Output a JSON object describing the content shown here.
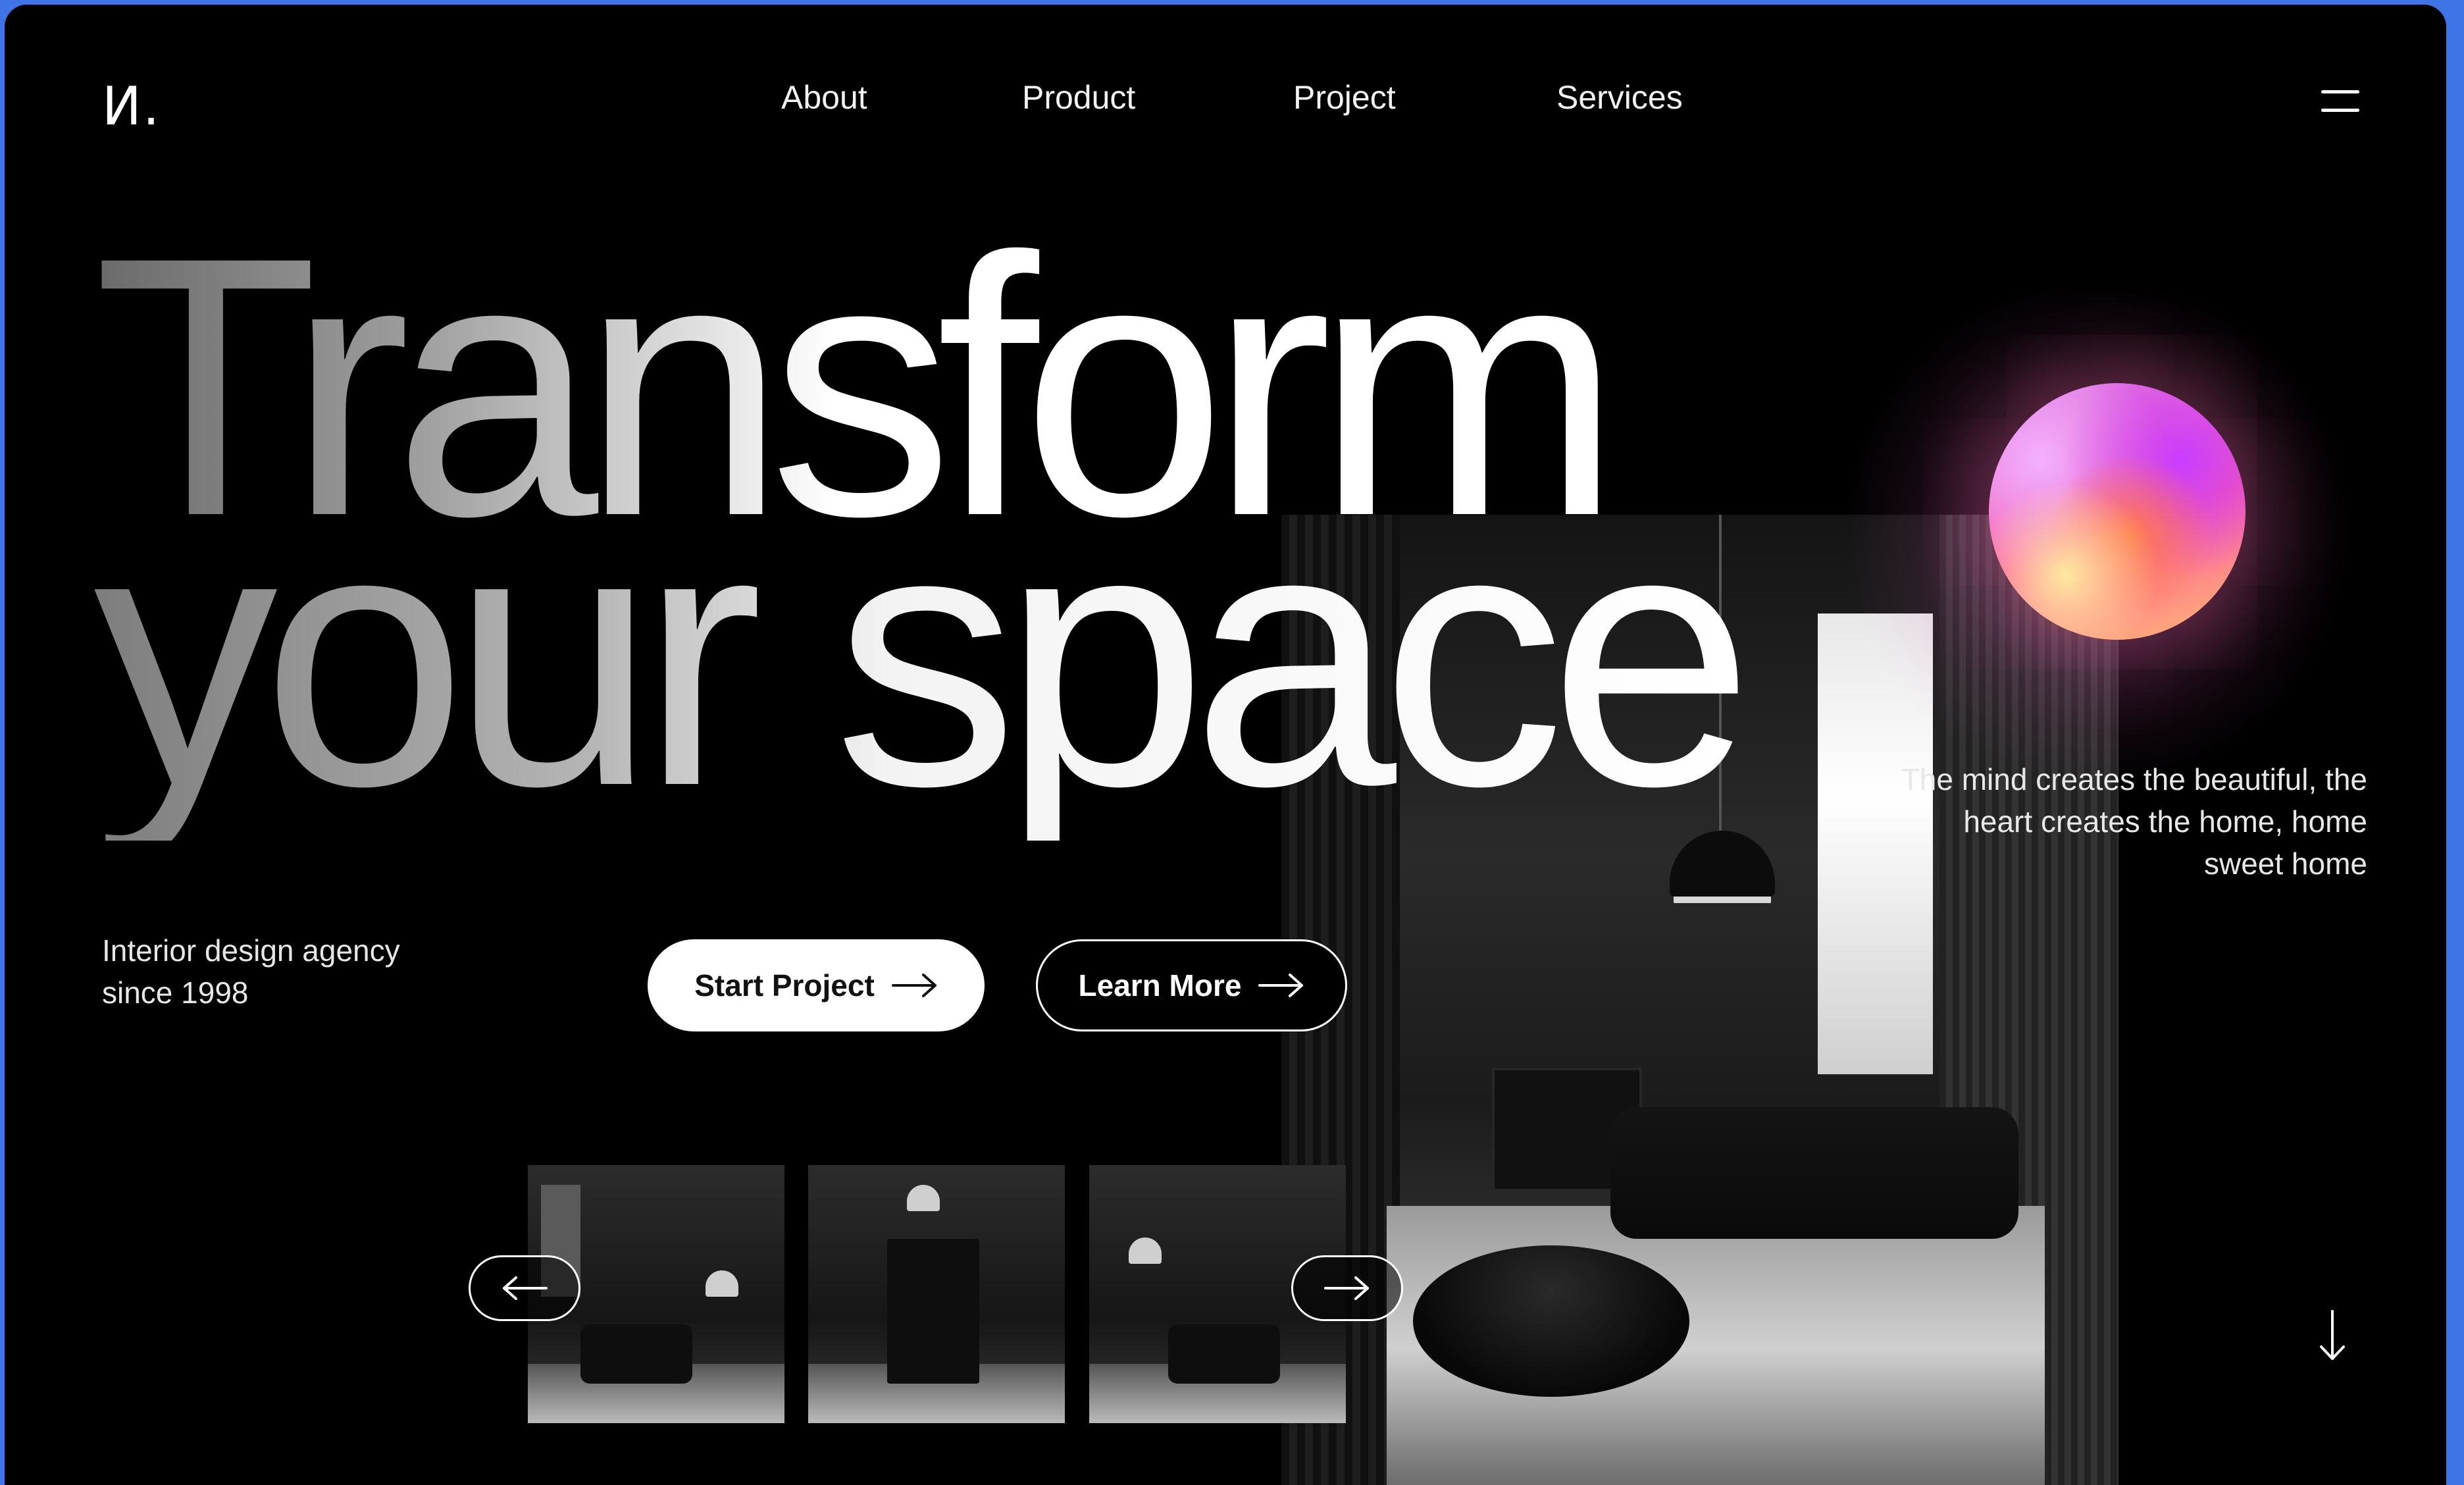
{
  "brand": {
    "logo_text": "И."
  },
  "nav": {
    "items": [
      {
        "label": "About"
      },
      {
        "label": "Product"
      },
      {
        "label": "Project"
      },
      {
        "label": "Services"
      }
    ],
    "menu_icon": "hamburger-icon"
  },
  "hero": {
    "headline_line1": "Transform",
    "headline_line2": "your space",
    "tagline": "Interior design agency\nsince 1998",
    "quote": "The mind creates the beautiful, the heart creates the home, home sweet home",
    "primary_button": {
      "label": "Start Project",
      "icon": "arrow-right-icon"
    },
    "secondary_button": {
      "label": "Learn More",
      "icon": "arrow-right-icon"
    }
  },
  "gallery": {
    "prev_icon": "arrow-left-icon",
    "next_icon": "arrow-right-icon",
    "thumbnails": [
      {
        "name": "living-room-thumbnail"
      },
      {
        "name": "study-room-thumbnail"
      },
      {
        "name": "reading-corner-thumbnail"
      }
    ]
  },
  "scroll_icon": "arrow-down-icon",
  "colors": {
    "background": "#000000",
    "frame_border": "#3f74e6",
    "text": "#ffffff",
    "orb_pink": "#ff5aa0",
    "orb_purple": "#c93cff",
    "orb_yellow": "#ffe9a0"
  }
}
